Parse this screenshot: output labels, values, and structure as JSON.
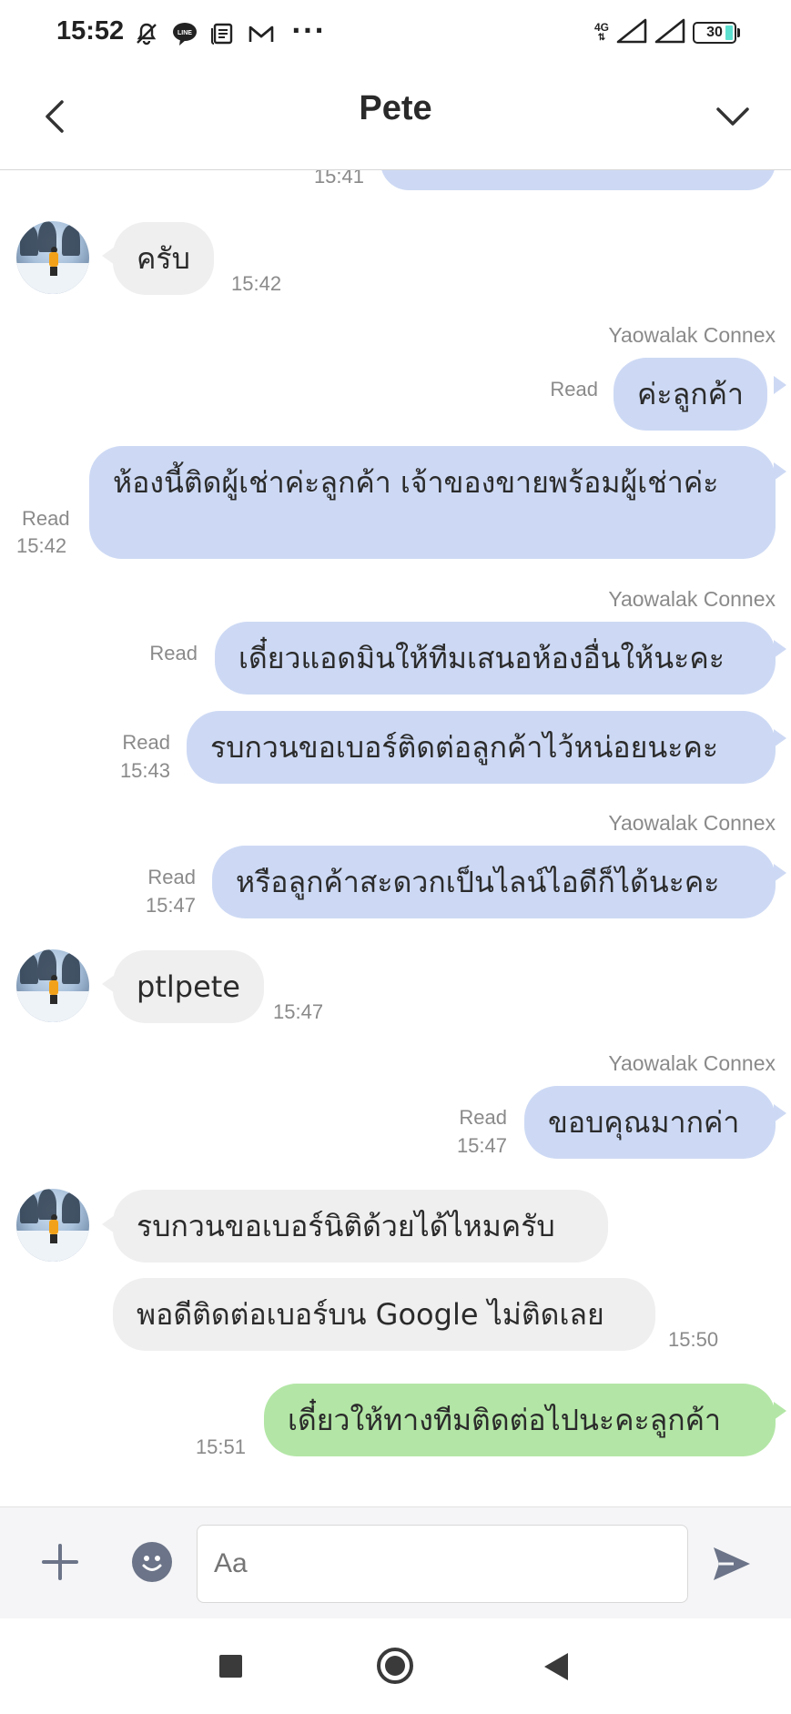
{
  "status_bar": {
    "time": "15:52",
    "network": "4G",
    "battery": "30",
    "icons": [
      "mute-bell-icon",
      "line-icon",
      "news-icon",
      "gmail-icon",
      "more-dots-icon",
      "signal-icon",
      "battery-icon"
    ]
  },
  "header": {
    "title": "Pete",
    "back_icon": "chevron-left-icon",
    "expand_icon": "chevron-down-icon"
  },
  "messages": [
    {
      "id": "m0",
      "side": "out",
      "text": "",
      "time": "15:41",
      "partial": true
    },
    {
      "id": "m1",
      "side": "in",
      "text": "ครับ",
      "time": "15:42"
    },
    {
      "id": "m2",
      "side": "out",
      "sender": "Yaowalak Connex",
      "text": "ค่ะลูกค้า",
      "read": "Read"
    },
    {
      "id": "m3",
      "side": "out",
      "text": "ห้องนี้ติดผู้เช่าค่ะลูกค้า เจ้าของขายพร้อมผู้เช่าค่ะ",
      "read": "Read",
      "time": "15:42"
    },
    {
      "id": "m4",
      "side": "out",
      "sender": "Yaowalak Connex",
      "text": "เดี๋ยวแอดมินให้ทีมเสนอห้องอื่นให้นะคะ",
      "read": "Read"
    },
    {
      "id": "m5",
      "side": "out",
      "text": "รบกวนขอเบอร์ติดต่อลูกค้าไว้หน่อยนะคะ",
      "read": "Read",
      "time": "15:43"
    },
    {
      "id": "m6",
      "side": "out",
      "sender": "Yaowalak Connex",
      "text": "หรือลูกค้าสะดวกเป็นไลน์ไอดีก็ได้นะคะ",
      "read": "Read",
      "time": "15:47"
    },
    {
      "id": "m7",
      "side": "in",
      "text": "ptlpete",
      "time": "15:47"
    },
    {
      "id": "m8",
      "side": "out",
      "sender": "Yaowalak Connex",
      "text": "ขอบคุณมากค่า",
      "read": "Read",
      "time": "15:47"
    },
    {
      "id": "m9",
      "side": "in",
      "text": "รบกวนขอเบอร์นิติด้วยได้ไหมครับ"
    },
    {
      "id": "m10",
      "side": "in",
      "text": "พอดีติดต่อเบอร์บน Google ไม่ติดเลย",
      "time": "15:50"
    },
    {
      "id": "m11",
      "side": "out",
      "text": "เดี๋ยวให้ทางทีมติดต่อไปนะคะลูกค้า",
      "time": "15:51",
      "color": "#b3e6a6"
    }
  ],
  "input_bar": {
    "placeholder": "Aa",
    "plus_icon": "plus-icon",
    "emoji_icon": "emoji-icon",
    "send_icon": "send-icon"
  },
  "nav_bar": {
    "icons": [
      "recents-square-icon",
      "home-circle-icon",
      "back-triangle-icon"
    ]
  },
  "colors": {
    "outgoing_bubble": "#cdd9f4",
    "incoming_bubble": "#efefef",
    "sent_unread_bubble": "#b3e6a6"
  }
}
